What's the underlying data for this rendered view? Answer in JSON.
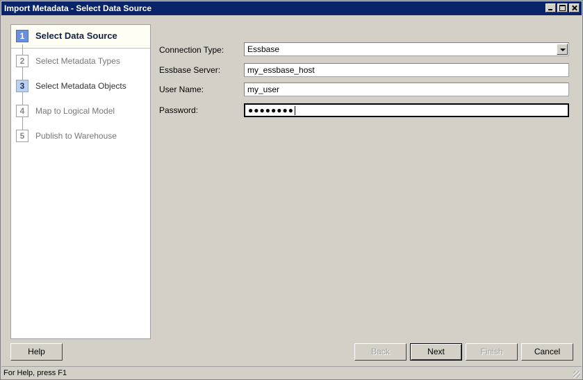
{
  "window": {
    "title": "Import Metadata - Select Data Source"
  },
  "steps": [
    {
      "num": "1",
      "label": "Select Data Source"
    },
    {
      "num": "2",
      "label": "Select Metadata Types"
    },
    {
      "num": "3",
      "label": "Select Metadata Objects"
    },
    {
      "num": "4",
      "label": "Map to Logical Model"
    },
    {
      "num": "5",
      "label": "Publish to Warehouse"
    }
  ],
  "form": {
    "connection_type": {
      "label": "Connection Type:",
      "value": "Essbase"
    },
    "server": {
      "label": "Essbase Server:",
      "value": "my_essbase_host"
    },
    "user": {
      "label": "User Name:",
      "value": "my_user"
    },
    "password": {
      "label": "Password:",
      "value": "●●●●●●●●"
    }
  },
  "buttons": {
    "help": "Help",
    "back": "Back",
    "next": "Next",
    "finish": "Finish",
    "cancel": "Cancel"
  },
  "status": {
    "text": "For Help, press F1"
  }
}
